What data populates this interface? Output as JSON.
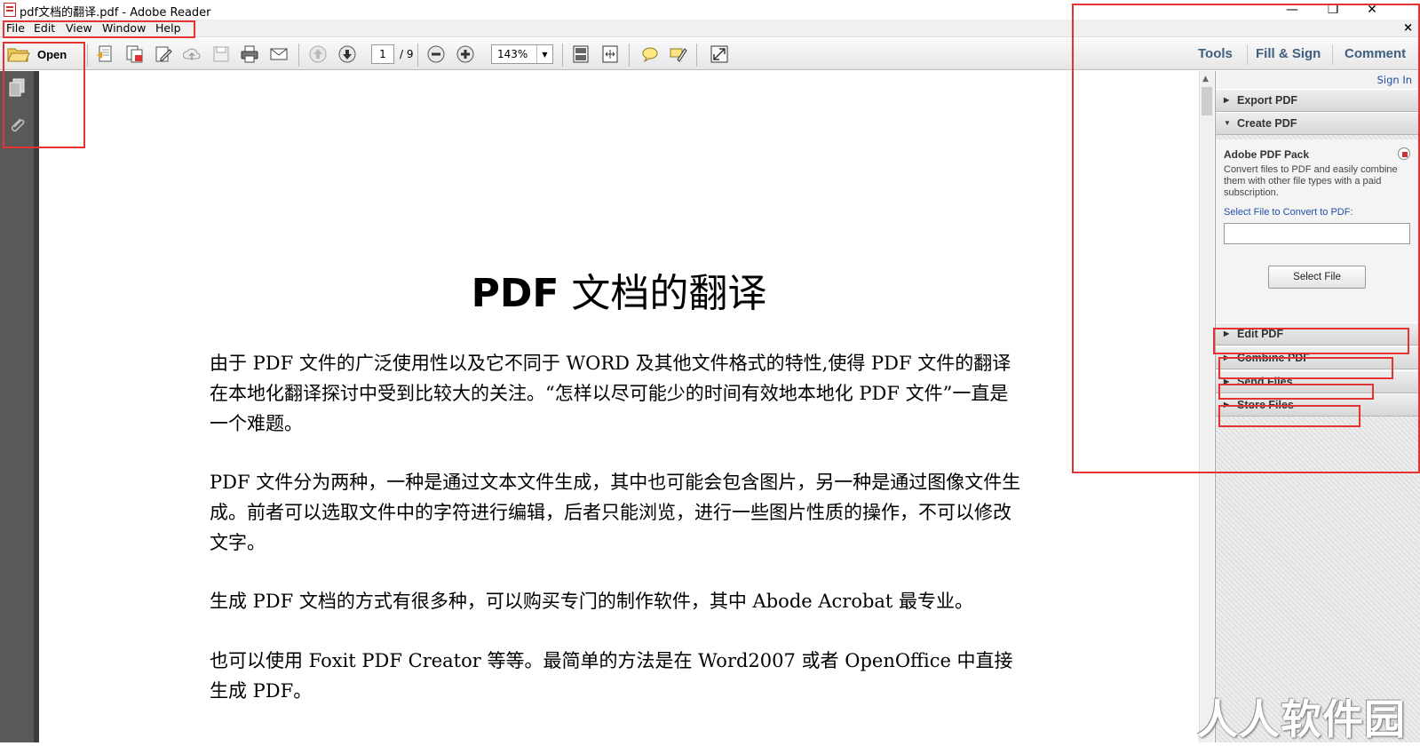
{
  "window": {
    "title": "pdf文档的翻译.pdf - Adobe Reader",
    "minimize_glyph": "—",
    "restore_glyph": "❐",
    "close_glyph": "✕"
  },
  "menu": {
    "items": [
      "File",
      "Edit",
      "View",
      "Window",
      "Help"
    ],
    "doc_close_glyph": "×"
  },
  "toolbar": {
    "open_label": "Open",
    "icons": [
      "open-folder-icon",
      "create-pdf-icon",
      "combine-pdf-icon",
      "edit-icon",
      "upload-icon",
      "save-icon",
      "print-icon",
      "email-icon",
      "previous-page-icon",
      "next-page-icon",
      "zoom-out-icon",
      "zoom-in-icon",
      "fit-page-icon",
      "fit-width-icon",
      "comment-icon",
      "highlight-icon",
      "fullscreen-icon"
    ],
    "page_current": "1",
    "page_total": "/ 9",
    "zoom": "143%",
    "tabs": {
      "tools": "Tools",
      "fill_sign": "Fill & Sign",
      "comment": "Comment"
    }
  },
  "leftnav": {
    "icons": [
      "page-thumbnails-icon",
      "attachments-icon"
    ]
  },
  "document": {
    "title_latin": "PDF",
    "title_cjk": "文档的翻译",
    "paragraphs": [
      "由于 PDF 文件的广泛使用性以及它不同于 WORD 及其他文件格式的特性,使得 PDF 文件的翻译在本地化翻译探讨中受到比较大的关注。“怎样以尽可能少的时间有效地本地化 PDF 文件”一直是一个难题。",
      "PDF 文件分为两种，一种是通过文本文件生成，其中也可能会包含图片，另一种是通过图像文件生成。前者可以选取文件中的字符进行编辑，后者只能浏览，进行一些图片性质的操作，不可以修改文字。",
      "生成 PDF 文档的方式有很多种，可以购买专门的制作软件，其中 Abode Acrobat 最专业。",
      "也可以使用 Foxit PDF Creator 等等。最简单的方法是在 Word2007 或者 OpenOffice 中直接生成 PDF。"
    ]
  },
  "right_panel": {
    "sign_in": "Sign In",
    "panes": {
      "export_pdf": "Export PDF",
      "create_pdf": "Create PDF",
      "edit_pdf": "Edit PDF",
      "combine_pdf": "Combine PDF",
      "send_files": "Send Files",
      "store_files": "Store Files"
    },
    "collapsed_arrow": "▶",
    "expanded_arrow": "▼",
    "create": {
      "pack_title": "Adobe PDF Pack",
      "pack_desc": "Convert files to PDF and easily combine them with other file types with a paid subscription.",
      "select_label": "Select File to Convert to PDF:",
      "file_value": "",
      "select_button": "Select File"
    }
  },
  "watermark": "人人软件园",
  "colors": {
    "annotation_red": "#e53333",
    "link_blue": "#1f4fa6",
    "tab_text": "#3f5f7f"
  }
}
